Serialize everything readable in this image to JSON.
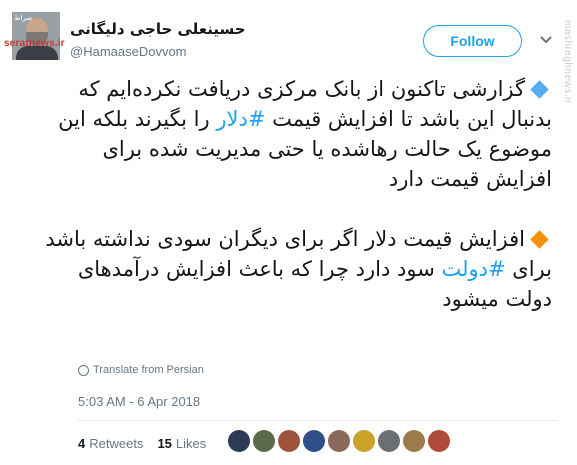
{
  "author": {
    "display_name": "حسینعلی حاجی دلیگانی",
    "handle": "@HamaaseDovvom",
    "avatar_icon": "profile-photo-icon",
    "watermark": "seratnews.ir",
    "avatar_tag": "صراط"
  },
  "follow_button": {
    "label": "Follow"
  },
  "side_watermark": "mashreghnews.ir",
  "tweet": {
    "paragraphs": [
      {
        "emoji": "blue-diamond",
        "text_before": "گزارشی تاکنون از بانک مرکزی دریافت نکرده‌ایم که بدنبال این باشد تا افزایش قیمت ",
        "hashtag": "#دلار",
        "text_after": " را بگیرند بلکه این موضوع یک حالت رهاشده یا حتی مدیریت شده برای افزایش قیمت دارد"
      },
      {
        "emoji": "orange-diamond",
        "text_before": "افزایش قیمت دلار اگر برای دیگران سودی نداشته باشد برای ",
        "hashtag": "#دولت",
        "text_after": " سود دارد چرا که باعث افزایش درآمدهای دولت میشود"
      }
    ]
  },
  "translate_link": "Translate from Persian",
  "timestamp": "5:03 AM - 6 Apr 2018",
  "stats": {
    "retweets_count": "4",
    "retweets_label": "Retweets",
    "likes_count": "15",
    "likes_label": "Likes"
  },
  "likers": [
    {
      "icon": "liker-avatar-icon",
      "color": "#2b3a55"
    },
    {
      "icon": "liker-avatar-icon",
      "color": "#5b6b4a"
    },
    {
      "icon": "liker-avatar-icon",
      "color": "#a0523d"
    },
    {
      "icon": "liker-avatar-icon",
      "color": "#2e4f8a"
    },
    {
      "icon": "liker-avatar-icon",
      "color": "#8a6a5a"
    },
    {
      "icon": "liker-avatar-icon",
      "color": "#c9a227"
    },
    {
      "icon": "liker-avatar-icon",
      "color": "#6b6e73"
    },
    {
      "icon": "liker-avatar-icon",
      "color": "#9b7a4b"
    },
    {
      "icon": "liker-avatar-icon",
      "color": "#b04a3a"
    }
  ]
}
